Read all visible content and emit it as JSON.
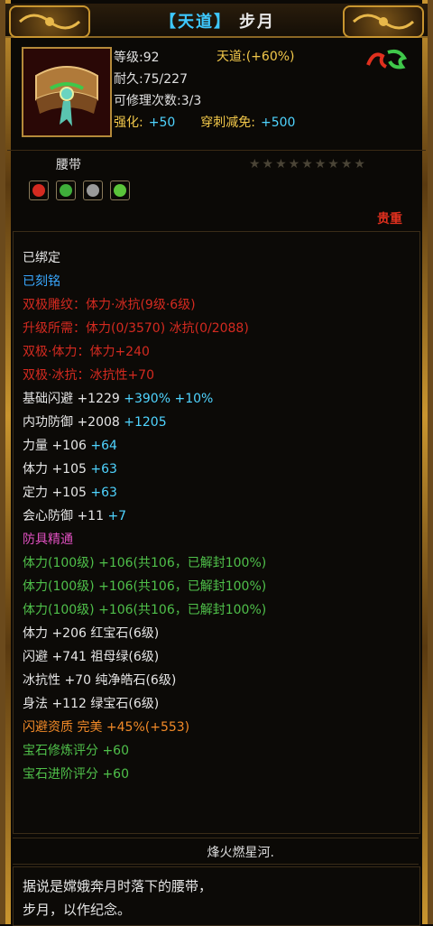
{
  "title": {
    "tag": "【天道】",
    "name": "步月"
  },
  "item": {
    "level_label": "等级:",
    "level": "92",
    "durability_label": "耐久:",
    "durability": "75/227",
    "repair_label": "可修理次数:",
    "repair": "3/3",
    "enhance_label": "强化:",
    "enhance": "+50",
    "pierce_label": "穿刺减免:",
    "pierce": "+500",
    "tiandao_label": "天道:",
    "tiandao": "(+60%)",
    "type": "腰带",
    "stars": "★★★★★★★★★",
    "bound_tag": "贵重",
    "slot_colors": [
      "#d42a20",
      "#3fae3a",
      "#9a9a9a",
      "#5ac43a"
    ]
  },
  "attributes": [
    {
      "text": "已绑定",
      "color": "white"
    },
    {
      "text": "已刻铭",
      "color": "blue"
    },
    {
      "text": "双极雕纹：体力·冰抗(9级·6级)",
      "color": "red"
    },
    {
      "text": "升级所需：体力(0/3570)  冰抗(0/2088)",
      "color": "red"
    },
    {
      "text": "双极·体力：体力+240",
      "color": "red"
    },
    {
      "text": "双极·冰抗：冰抗性+70",
      "color": "red"
    },
    {
      "segments": [
        {
          "text": "基础闪避 +1229 ",
          "color": "white"
        },
        {
          "text": "+390% +10%",
          "color": "cyan"
        }
      ]
    },
    {
      "segments": [
        {
          "text": "内功防御 +2008 ",
          "color": "white"
        },
        {
          "text": "+1205",
          "color": "cyan"
        }
      ]
    },
    {
      "segments": [
        {
          "text": "力量 +106 ",
          "color": "white"
        },
        {
          "text": "+64",
          "color": "cyan"
        }
      ]
    },
    {
      "segments": [
        {
          "text": "体力 +105 ",
          "color": "white"
        },
        {
          "text": "+63",
          "color": "cyan"
        }
      ]
    },
    {
      "segments": [
        {
          "text": "定力 +105 ",
          "color": "white"
        },
        {
          "text": "+63",
          "color": "cyan"
        }
      ]
    },
    {
      "segments": [
        {
          "text": "会心防御 +11 ",
          "color": "white"
        },
        {
          "text": "+7",
          "color": "cyan"
        }
      ]
    },
    {
      "text": "防具精通",
      "color": "pink"
    },
    {
      "text": "体力(100级) +106(共106，已解封100%)",
      "color": "green"
    },
    {
      "text": "体力(100级) +106(共106，已解封100%)",
      "color": "green"
    },
    {
      "text": "体力(100级) +106(共106，已解封100%)",
      "color": "green"
    },
    {
      "text": "体力 +206 红宝石(6级)",
      "color": "white"
    },
    {
      "text": "闪避 +741 祖母绿(6级)",
      "color": "white"
    },
    {
      "text": "冰抗性 +70 纯净皓石(6级)",
      "color": "white"
    },
    {
      "text": "身法 +112 绿宝石(6级)",
      "color": "white"
    },
    {
      "text": "闪避资质  完美 +45%(+553)",
      "color": "orange"
    },
    {
      "text": "宝石修炼评分 +60",
      "color": "green"
    },
    {
      "text": "宝石进阶评分 +60",
      "color": "green"
    }
  ],
  "footer": {
    "title": "烽火燃星河.",
    "desc_line1": "据说是嫦娥奔月时落下的腰带，",
    "desc_line2": "步月，以作纪念。"
  },
  "colors": {
    "white": "#e6e6e6",
    "blue": "#39a8ff",
    "red": "#d42a20",
    "green": "#4fc04a",
    "cyan": "#4fd4ff",
    "pink": "#e050c0",
    "orange": "#f28a28",
    "gold": "#f2c84a"
  }
}
